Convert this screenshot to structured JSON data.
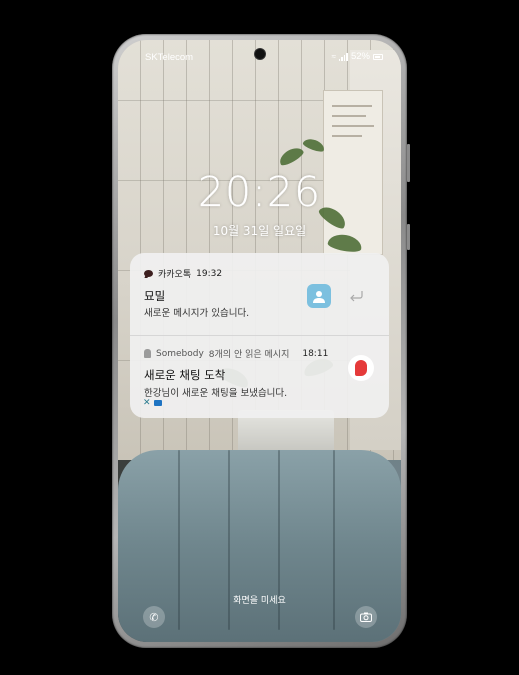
{
  "status_bar": {
    "carrier": "SKTelecom",
    "battery_percent": "52%"
  },
  "lock_screen": {
    "time": "20:26",
    "date": "10월 31일 일요일",
    "swipe_hint": "화면을 미세요"
  },
  "notifications": {
    "kakao": {
      "app_name": "카카오톡",
      "time": "19:32",
      "sender": "묘밀",
      "message": "새로운 메시지가 있습니다."
    },
    "somebody": {
      "app_name": "Somebody",
      "unread": "8개의 안 읽은 메시지",
      "time": "18:11",
      "title": "새로운 채팅 도착",
      "message": "한강님이 새로운 채팅을 보냈습니다."
    }
  },
  "icons": {
    "phone_shortcut": "phone-icon",
    "camera_shortcut": "camera-icon"
  }
}
